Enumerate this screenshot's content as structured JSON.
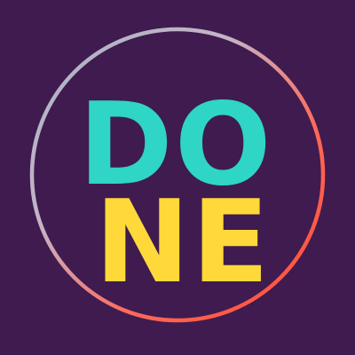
{
  "logo": {
    "line_1": "DO",
    "line_2": "NE"
  },
  "colors": {
    "background": "#3f1b4f",
    "line_1": "#2fd5c6",
    "line_2": "#ffd93a",
    "ring_gradient": [
      "#b0b8c8",
      "#c6b0c0",
      "#ff5a4a",
      "#ff4a3a"
    ]
  }
}
